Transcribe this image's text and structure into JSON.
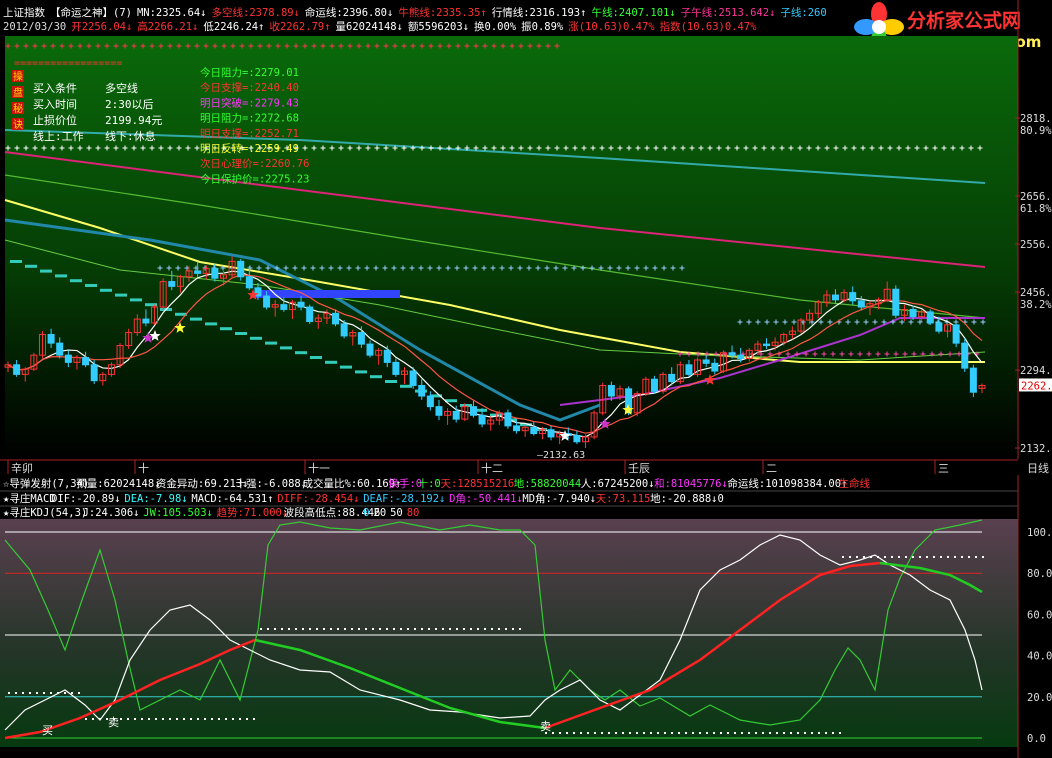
{
  "header": {
    "line1": [
      {
        "text": "上证指数",
        "color": "#ffffff"
      },
      {
        "text": "【命运之神】(7)",
        "color": "#ffffff"
      },
      {
        "text": "MN:2325.64↓",
        "color": "#ffffff"
      },
      {
        "text": "多空线:2378.89↓",
        "color": "#ff3333"
      },
      {
        "text": "命运线:2396.80↓",
        "color": "#ffffff"
      },
      {
        "text": "牛熊线:2335.35↑",
        "color": "#ff3333"
      },
      {
        "text": "行情线:2316.193↑",
        "color": "#ffffff"
      },
      {
        "text": "午线:2407.101↓",
        "color": "#33ff33"
      },
      {
        "text": "子午线:2513.642↓",
        "color": "#ff3399"
      },
      {
        "text": "子线:260",
        "color": "#33ccff"
      }
    ],
    "line2": [
      {
        "text": "2012/03/30",
        "color": "#dddddd"
      },
      {
        "text": "开2256.04↓",
        "color": "#ff3333"
      },
      {
        "text": "高2266.21↓",
        "color": "#ff3333"
      },
      {
        "text": "低2246.24↑",
        "color": "#ffffff"
      },
      {
        "text": "收2262.79↑",
        "color": "#ff3333"
      },
      {
        "text": "量62024148↓",
        "color": "#ffffff"
      },
      {
        "text": "额5596203↓",
        "color": "#ffffff"
      },
      {
        "text": "换0.00%",
        "color": "#ffffff"
      },
      {
        "text": "振0.89%",
        "color": "#ffffff"
      },
      {
        "text": "涨(10.63)0.47%",
        "color": "#ff3333"
      },
      {
        "text": "指数(10.63)0.47%",
        "color": "#ff3333"
      }
    ]
  },
  "logo": {
    "text": "分析家公式网",
    "url": "www.88gs.com"
  },
  "info_left": [
    {
      "k": "买入条件",
      "v": "多空线"
    },
    {
      "k": "买入时间",
      "v": "2:30以后"
    },
    {
      "k": "止损价位",
      "v": "2199.94元"
    },
    {
      "k": "线上:工作",
      "v": "线下:休息"
    }
  ],
  "info_left_side_chars": [
    "操",
    "盘",
    "秘",
    "诀"
  ],
  "info_right": [
    {
      "text": "今日阻力=:2279.01",
      "color": "#33ff33"
    },
    {
      "text": "今日支撑=:2240.40",
      "color": "#ff3333"
    },
    {
      "text": "明日突破=:2279.43",
      "color": "#ff33ff"
    },
    {
      "text": "明日阻力=:2272.68",
      "color": "#33ff33"
    },
    {
      "text": "明日支撑=:2252.71",
      "color": "#ff3333"
    },
    {
      "text": "明日反转=:2259.49",
      "color": "#ffff33"
    },
    {
      "text": "次日心理价=:2260.76",
      "color": "#ff3333"
    },
    {
      "text": "今日保护价=:2275.23",
      "color": "#33ff33"
    }
  ],
  "price_axis": [
    {
      "label": "2818.",
      "sub": "80.9%",
      "v": 2818
    },
    {
      "label": "2656.",
      "sub": "61.8%",
      "v": 2656
    },
    {
      "label": "2556.",
      "sub": "",
      "v": 2556
    },
    {
      "label": "2456.",
      "sub": "38.2%",
      "v": 2456
    },
    {
      "label": "2294.",
      "sub": "",
      "v": 2294
    },
    {
      "label": "2132.",
      "sub": "",
      "v": 2132
    }
  ],
  "current_price_tag": "2262.",
  "low_annotation": "2132.63",
  "date_axis": [
    "辛卯",
    "十",
    "十一",
    "十二",
    "壬辰",
    "二",
    "三"
  ],
  "period_label": "日线",
  "ind1": [
    {
      "text": "☆导弹发射(7,34)",
      "color": "#ffffff"
    },
    {
      "text": "预量:62024148↓",
      "color": "#ffffff"
    },
    {
      "text": "资金异动:69.213↓",
      "color": "#ffffff"
    },
    {
      "text": "十强:-6.088↓",
      "color": "#ffffff"
    },
    {
      "text": "成交量比%:60.169↑",
      "color": "#ffffff"
    },
    {
      "text": "换手:0",
      "color": "#ff33ff"
    },
    {
      "text": "十:0",
      "color": "#33ff33"
    },
    {
      "text": "天:128515216",
      "color": "#ff3333"
    },
    {
      "text": "地:58820044",
      "color": "#33ff33"
    },
    {
      "text": "人:67245200↓",
      "color": "#ffffff"
    },
    {
      "text": "和:81045776↓",
      "color": "#ff33ff"
    },
    {
      "text": "命运线:101098384.00↑",
      "color": "#ffffff"
    },
    {
      "text": "生命线",
      "color": "#ff3333"
    }
  ],
  "ind2": [
    {
      "text": "★寻庄MACD",
      "color": "#ffffff"
    },
    {
      "text": "DIF:-20.89↓",
      "color": "#ffffff"
    },
    {
      "text": "DEA:-7.98↓",
      "color": "#33ffff"
    },
    {
      "text": "MACD:-64.531↑",
      "color": "#ffffff"
    },
    {
      "text": "DIFF:-28.454↓",
      "color": "#ff3333"
    },
    {
      "text": "DEAF:-28.192↓",
      "color": "#33ccff"
    },
    {
      "text": "D角:-50.441↓",
      "color": "#ff33ff"
    },
    {
      "text": "MD角:-7.940↓",
      "color": "#ffffff"
    },
    {
      "text": "天:73.115",
      "color": "#ff3333"
    },
    {
      "text": "地:-20.888↓0",
      "color": "#ffffff"
    }
  ],
  "ind3": [
    {
      "text": "★寻庄KDJ(54,3)",
      "color": "#ffffff"
    },
    {
      "text": "J:24.306↓",
      "color": "#ffffff"
    },
    {
      "text": "JW:105.503↓",
      "color": "#33ff33"
    },
    {
      "text": "趋势:71.000↓",
      "color": "#ff3333"
    },
    {
      "text": "波段高低点:88.446",
      "color": "#ffffff"
    },
    {
      "text": "0",
      "color": "#33ccff"
    },
    {
      "text": "20",
      "color": "#ffffff"
    },
    {
      "text": "50",
      "color": "#ffffff"
    },
    {
      "text": "80",
      "color": "#ff3333"
    }
  ],
  "kdj_axis": [
    "100.0",
    "80.0",
    "60.0",
    "40.0",
    "20.0",
    "0.0"
  ],
  "signal_labels": {
    "buy": "买",
    "buy2": "卖",
    "sell": "卖"
  },
  "colors": {
    "bull": "#ff3333",
    "bear": "#33ccff",
    "ma1": "#ffffff",
    "ma2": "#ff3333",
    "ma3": "#ffff66",
    "trend": "#ff2222",
    "trend_down": "#22cc22",
    "j": "#33cc33",
    "k": "#ffffff"
  },
  "chart_data": {
    "type": "candlestick",
    "title": "上证指数 日线",
    "ylim": [
      2132,
      2900
    ],
    "candles": [
      {
        "o": 2300,
        "h": 2312,
        "l": 2290,
        "c": 2305
      },
      {
        "o": 2305,
        "h": 2315,
        "l": 2280,
        "c": 2285
      },
      {
        "o": 2285,
        "h": 2300,
        "l": 2270,
        "c": 2296
      },
      {
        "o": 2296,
        "h": 2330,
        "l": 2292,
        "c": 2325
      },
      {
        "o": 2325,
        "h": 2375,
        "l": 2318,
        "c": 2368
      },
      {
        "o": 2368,
        "h": 2380,
        "l": 2340,
        "c": 2350
      },
      {
        "o": 2350,
        "h": 2362,
        "l": 2318,
        "c": 2325
      },
      {
        "o": 2325,
        "h": 2335,
        "l": 2300,
        "c": 2310
      },
      {
        "o": 2310,
        "h": 2325,
        "l": 2295,
        "c": 2320
      },
      {
        "o": 2320,
        "h": 2332,
        "l": 2300,
        "c": 2305
      },
      {
        "o": 2305,
        "h": 2315,
        "l": 2265,
        "c": 2272
      },
      {
        "o": 2272,
        "h": 2290,
        "l": 2262,
        "c": 2285
      },
      {
        "o": 2285,
        "h": 2310,
        "l": 2280,
        "c": 2305
      },
      {
        "o": 2305,
        "h": 2350,
        "l": 2298,
        "c": 2345
      },
      {
        "o": 2345,
        "h": 2380,
        "l": 2338,
        "c": 2372
      },
      {
        "o": 2372,
        "h": 2410,
        "l": 2365,
        "c": 2400
      },
      {
        "o": 2400,
        "h": 2420,
        "l": 2385,
        "c": 2392
      },
      {
        "o": 2392,
        "h": 2430,
        "l": 2388,
        "c": 2425
      },
      {
        "o": 2425,
        "h": 2485,
        "l": 2420,
        "c": 2478
      },
      {
        "o": 2478,
        "h": 2500,
        "l": 2460,
        "c": 2468
      },
      {
        "o": 2468,
        "h": 2492,
        "l": 2455,
        "c": 2488
      },
      {
        "o": 2488,
        "h": 2510,
        "l": 2478,
        "c": 2500
      },
      {
        "o": 2500,
        "h": 2520,
        "l": 2488,
        "c": 2495
      },
      {
        "o": 2495,
        "h": 2512,
        "l": 2482,
        "c": 2505
      },
      {
        "o": 2505,
        "h": 2515,
        "l": 2478,
        "c": 2485
      },
      {
        "o": 2485,
        "h": 2500,
        "l": 2470,
        "c": 2492
      },
      {
        "o": 2492,
        "h": 2530,
        "l": 2485,
        "c": 2520
      },
      {
        "o": 2520,
        "h": 2525,
        "l": 2480,
        "c": 2488
      },
      {
        "o": 2488,
        "h": 2510,
        "l": 2460,
        "c": 2465
      },
      {
        "o": 2465,
        "h": 2475,
        "l": 2440,
        "c": 2448
      },
      {
        "o": 2448,
        "h": 2458,
        "l": 2420,
        "c": 2425
      },
      {
        "o": 2425,
        "h": 2440,
        "l": 2405,
        "c": 2430
      },
      {
        "o": 2430,
        "h": 2445,
        "l": 2415,
        "c": 2420
      },
      {
        "o": 2420,
        "h": 2440,
        "l": 2400,
        "c": 2435
      },
      {
        "o": 2435,
        "h": 2448,
        "l": 2418,
        "c": 2425
      },
      {
        "o": 2425,
        "h": 2430,
        "l": 2390,
        "c": 2395
      },
      {
        "o": 2395,
        "h": 2410,
        "l": 2380,
        "c": 2402
      },
      {
        "o": 2402,
        "h": 2420,
        "l": 2390,
        "c": 2412
      },
      {
        "o": 2412,
        "h": 2420,
        "l": 2385,
        "c": 2390
      },
      {
        "o": 2390,
        "h": 2398,
        "l": 2360,
        "c": 2365
      },
      {
        "o": 2365,
        "h": 2378,
        "l": 2345,
        "c": 2372
      },
      {
        "o": 2372,
        "h": 2385,
        "l": 2340,
        "c": 2348
      },
      {
        "o": 2348,
        "h": 2356,
        "l": 2320,
        "c": 2325
      },
      {
        "o": 2325,
        "h": 2340,
        "l": 2305,
        "c": 2335
      },
      {
        "o": 2335,
        "h": 2345,
        "l": 2300,
        "c": 2310
      },
      {
        "o": 2310,
        "h": 2318,
        "l": 2280,
        "c": 2285
      },
      {
        "o": 2285,
        "h": 2300,
        "l": 2265,
        "c": 2292
      },
      {
        "o": 2292,
        "h": 2300,
        "l": 2255,
        "c": 2262
      },
      {
        "o": 2262,
        "h": 2275,
        "l": 2232,
        "c": 2240
      },
      {
        "o": 2240,
        "h": 2250,
        "l": 2210,
        "c": 2218
      },
      {
        "o": 2218,
        "h": 2232,
        "l": 2190,
        "c": 2200
      },
      {
        "o": 2200,
        "h": 2215,
        "l": 2180,
        "c": 2208
      },
      {
        "o": 2208,
        "h": 2220,
        "l": 2185,
        "c": 2192
      },
      {
        "o": 2192,
        "h": 2225,
        "l": 2188,
        "c": 2218
      },
      {
        "o": 2218,
        "h": 2230,
        "l": 2195,
        "c": 2200
      },
      {
        "o": 2200,
        "h": 2215,
        "l": 2175,
        "c": 2182
      },
      {
        "o": 2182,
        "h": 2198,
        "l": 2168,
        "c": 2190
      },
      {
        "o": 2190,
        "h": 2210,
        "l": 2180,
        "c": 2205
      },
      {
        "o": 2205,
        "h": 2212,
        "l": 2172,
        "c": 2178
      },
      {
        "o": 2178,
        "h": 2188,
        "l": 2162,
        "c": 2168
      },
      {
        "o": 2168,
        "h": 2180,
        "l": 2155,
        "c": 2175
      },
      {
        "o": 2175,
        "h": 2186,
        "l": 2158,
        "c": 2162
      },
      {
        "o": 2162,
        "h": 2176,
        "l": 2150,
        "c": 2170
      },
      {
        "o": 2170,
        "h": 2178,
        "l": 2148,
        "c": 2155
      },
      {
        "o": 2155,
        "h": 2168,
        "l": 2140,
        "c": 2162
      },
      {
        "o": 2162,
        "h": 2175,
        "l": 2150,
        "c": 2158
      },
      {
        "o": 2158,
        "h": 2168,
        "l": 2140,
        "c": 2145
      },
      {
        "o": 2145,
        "h": 2160,
        "l": 2132,
        "c": 2155
      },
      {
        "o": 2155,
        "h": 2210,
        "l": 2150,
        "c": 2205
      },
      {
        "o": 2205,
        "h": 2268,
        "l": 2200,
        "c": 2262
      },
      {
        "o": 2262,
        "h": 2270,
        "l": 2230,
        "c": 2240
      },
      {
        "o": 2240,
        "h": 2262,
        "l": 2232,
        "c": 2255
      },
      {
        "o": 2255,
        "h": 2260,
        "l": 2200,
        "c": 2205
      },
      {
        "o": 2205,
        "h": 2250,
        "l": 2198,
        "c": 2245
      },
      {
        "o": 2245,
        "h": 2280,
        "l": 2240,
        "c": 2275
      },
      {
        "o": 2275,
        "h": 2282,
        "l": 2245,
        "c": 2250
      },
      {
        "o": 2250,
        "h": 2290,
        "l": 2245,
        "c": 2285
      },
      {
        "o": 2285,
        "h": 2300,
        "l": 2262,
        "c": 2270
      },
      {
        "o": 2270,
        "h": 2312,
        "l": 2265,
        "c": 2305
      },
      {
        "o": 2305,
        "h": 2315,
        "l": 2280,
        "c": 2285
      },
      {
        "o": 2285,
        "h": 2320,
        "l": 2280,
        "c": 2315
      },
      {
        "o": 2315,
        "h": 2325,
        "l": 2300,
        "c": 2308
      },
      {
        "o": 2308,
        "h": 2318,
        "l": 2285,
        "c": 2292
      },
      {
        "o": 2292,
        "h": 2335,
        "l": 2288,
        "c": 2330
      },
      {
        "o": 2330,
        "h": 2345,
        "l": 2318,
        "c": 2325
      },
      {
        "o": 2325,
        "h": 2340,
        "l": 2310,
        "c": 2318
      },
      {
        "o": 2318,
        "h": 2340,
        "l": 2312,
        "c": 2335
      },
      {
        "o": 2335,
        "h": 2355,
        "l": 2325,
        "c": 2348
      },
      {
        "o": 2348,
        "h": 2360,
        "l": 2338,
        "c": 2345
      },
      {
        "o": 2345,
        "h": 2362,
        "l": 2335,
        "c": 2352
      },
      {
        "o": 2352,
        "h": 2372,
        "l": 2345,
        "c": 2368
      },
      {
        "o": 2368,
        "h": 2385,
        "l": 2358,
        "c": 2375
      },
      {
        "o": 2375,
        "h": 2402,
        "l": 2370,
        "c": 2398
      },
      {
        "o": 2398,
        "h": 2420,
        "l": 2390,
        "c": 2412
      },
      {
        "o": 2412,
        "h": 2440,
        "l": 2402,
        "c": 2435
      },
      {
        "o": 2435,
        "h": 2460,
        "l": 2425,
        "c": 2450
      },
      {
        "o": 2450,
        "h": 2462,
        "l": 2432,
        "c": 2440
      },
      {
        "o": 2440,
        "h": 2462,
        "l": 2435,
        "c": 2455
      },
      {
        "o": 2455,
        "h": 2468,
        "l": 2430,
        "c": 2438
      },
      {
        "o": 2438,
        "h": 2448,
        "l": 2418,
        "c": 2425
      },
      {
        "o": 2425,
        "h": 2438,
        "l": 2408,
        "c": 2432
      },
      {
        "o": 2432,
        "h": 2445,
        "l": 2420,
        "c": 2440
      },
      {
        "o": 2440,
        "h": 2478,
        "l": 2435,
        "c": 2462
      },
      {
        "o": 2462,
        "h": 2470,
        "l": 2402,
        "c": 2408
      },
      {
        "o": 2408,
        "h": 2430,
        "l": 2396,
        "c": 2420
      },
      {
        "o": 2420,
        "h": 2428,
        "l": 2398,
        "c": 2405
      },
      {
        "o": 2405,
        "h": 2420,
        "l": 2395,
        "c": 2415
      },
      {
        "o": 2415,
        "h": 2420,
        "l": 2388,
        "c": 2392
      },
      {
        "o": 2392,
        "h": 2405,
        "l": 2370,
        "c": 2375
      },
      {
        "o": 2375,
        "h": 2392,
        "l": 2362,
        "c": 2388
      },
      {
        "o": 2388,
        "h": 2392,
        "l": 2342,
        "c": 2350
      },
      {
        "o": 2350,
        "h": 2360,
        "l": 2290,
        "c": 2298
      },
      {
        "o": 2298,
        "h": 2305,
        "l": 2238,
        "c": 2248
      },
      {
        "o": 2256,
        "h": 2266,
        "l": 2246,
        "c": 2262
      }
    ]
  }
}
